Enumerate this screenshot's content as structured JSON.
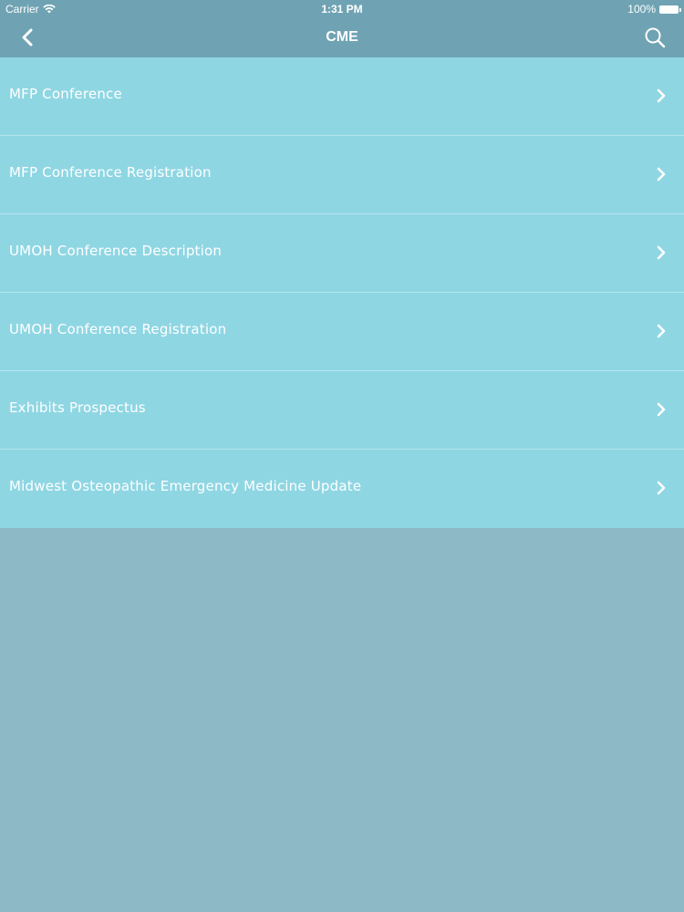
{
  "status_bar": {
    "carrier": "Carrier",
    "time": "1:31 PM",
    "battery": "100%"
  },
  "nav": {
    "title": "CME",
    "back_icon": "chevron-left-icon",
    "search_icon": "search-icon"
  },
  "menu": {
    "items": [
      {
        "label": "MFP Conference"
      },
      {
        "label": "MFP Conference Registration"
      },
      {
        "label": "UMOH Conference Description"
      },
      {
        "label": "UMOH Conference Registration"
      },
      {
        "label": "Exhibits Prospectus"
      },
      {
        "label": "Midwest Osteopathic Emergency Medicine Update"
      }
    ]
  },
  "colors": {
    "nav_background": "#6fa3b3",
    "list_background": "#8fd6e3",
    "page_background": "#8db8c5",
    "text": "#ffffff"
  }
}
